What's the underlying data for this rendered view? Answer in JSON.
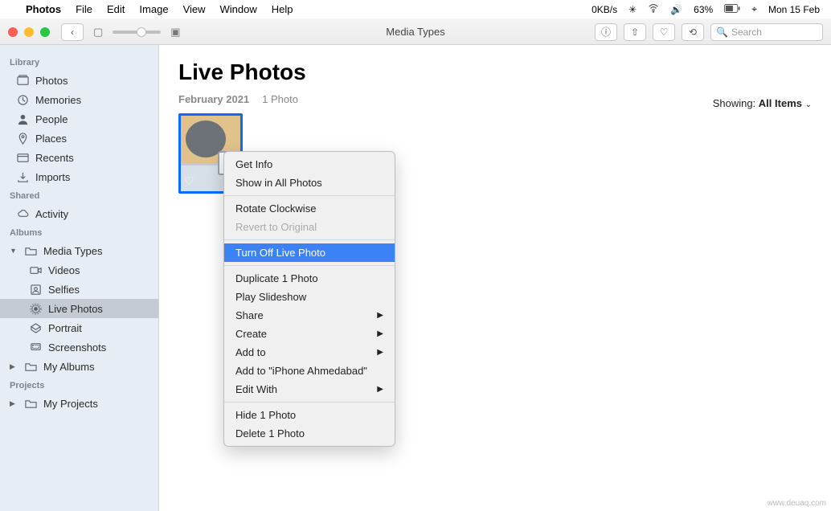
{
  "menubar": {
    "app": "Photos",
    "items": [
      "File",
      "Edit",
      "Image",
      "View",
      "Window",
      "Help"
    ],
    "network": "0KB/s",
    "battery": "63%",
    "date": "Mon 15 Feb"
  },
  "toolbar": {
    "window_title": "Media Types",
    "search_placeholder": "Search"
  },
  "sidebar": {
    "sections": {
      "library": "Library",
      "shared": "Shared",
      "albums": "Albums",
      "projects": "Projects"
    },
    "library": [
      "Photos",
      "Memories",
      "People",
      "Places",
      "Recents",
      "Imports"
    ],
    "shared": [
      "Activity"
    ],
    "albums_header": "Media Types",
    "media_types": [
      "Videos",
      "Selfies",
      "Live Photos",
      "Portrait",
      "Screenshots"
    ],
    "my_albums": "My Albums",
    "my_projects": "My Projects"
  },
  "content": {
    "title": "Live Photos",
    "date": "February 2021",
    "count": "1 Photo",
    "showing_label": "Showing:",
    "showing_value": "All Items"
  },
  "context_menu": {
    "items": [
      {
        "label": "Get Info",
        "type": "item"
      },
      {
        "label": "Show in All Photos",
        "type": "item"
      },
      {
        "type": "sep"
      },
      {
        "label": "Rotate Clockwise",
        "type": "item"
      },
      {
        "label": "Revert to Original",
        "type": "disabled"
      },
      {
        "type": "sep"
      },
      {
        "label": "Turn Off Live Photo",
        "type": "highlight"
      },
      {
        "type": "sep"
      },
      {
        "label": "Duplicate 1 Photo",
        "type": "item"
      },
      {
        "label": "Play Slideshow",
        "type": "item"
      },
      {
        "label": "Share",
        "type": "submenu"
      },
      {
        "label": "Create",
        "type": "submenu"
      },
      {
        "label": "Add to",
        "type": "submenu"
      },
      {
        "label": "Add to \"iPhone Ahmedabad\"",
        "type": "item"
      },
      {
        "label": "Edit With",
        "type": "submenu"
      },
      {
        "type": "sep"
      },
      {
        "label": "Hide 1 Photo",
        "type": "item"
      },
      {
        "label": "Delete 1 Photo",
        "type": "item"
      }
    ]
  },
  "watermark": "www.deuaq.com"
}
